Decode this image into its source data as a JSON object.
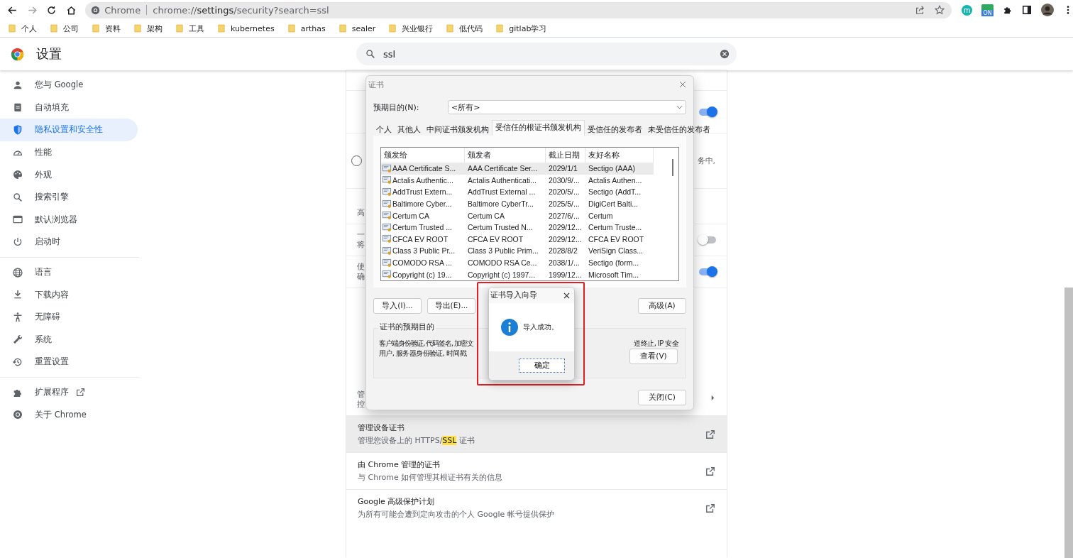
{
  "toolbar": {
    "nav": [
      {
        "kind": "back",
        "disabled": false
      },
      {
        "kind": "forward",
        "disabled": true
      },
      {
        "kind": "reload",
        "disabled": false
      },
      {
        "kind": "home",
        "disabled": false
      }
    ],
    "address_bar": {
      "site_label": "Chrome",
      "url": "chrome://**settings**/security?search=ssl"
    },
    "extensions": [
      {
        "kind": "letter",
        "text": "m"
      },
      {
        "kind": "badge",
        "text": "ON"
      },
      {
        "kind": "puzzle"
      },
      {
        "kind": "side-panel"
      },
      {
        "kind": "avatar"
      },
      {
        "kind": "menu"
      }
    ]
  },
  "bookmarks": [
    "个人",
    "公司",
    "资料",
    "架构",
    "工具",
    "kubernetes",
    "arthas",
    "sealer",
    "兴业银行",
    "低代码",
    "gitlab学习"
  ],
  "header": {
    "title": "设置",
    "search": {
      "value": "ssl"
    }
  },
  "sidebar": {
    "groups": [
      [
        {
          "kind": "person",
          "label": "您与 Google",
          "selected": false
        },
        {
          "kind": "clipboard",
          "label": "自动填充",
          "selected": false
        },
        {
          "kind": "shield",
          "label": "隐私设置和安全性",
          "selected": true
        },
        {
          "kind": "gauge",
          "label": "性能",
          "selected": false
        },
        {
          "kind": "palette",
          "label": "外观",
          "selected": false
        },
        {
          "kind": "search",
          "label": "搜索引擎",
          "selected": false
        },
        {
          "kind": "browser",
          "label": "默认浏览器",
          "selected": false
        },
        {
          "kind": "power",
          "label": "启动时",
          "selected": false
        }
      ],
      [
        {
          "kind": "globe",
          "label": "语言",
          "selected": false
        },
        {
          "kind": "download",
          "label": "下载内容",
          "selected": false
        },
        {
          "kind": "accessibility",
          "label": "无障碍",
          "selected": false
        },
        {
          "kind": "wrench",
          "label": "系统",
          "selected": false
        },
        {
          "kind": "history",
          "label": "重置设置",
          "selected": false
        }
      ],
      [
        {
          "kind": "puzzle",
          "label": "扩展程序",
          "selected": false,
          "external": true
        },
        {
          "kind": "chrome",
          "label": "关于 Chrome",
          "selected": false,
          "external": false
        }
      ]
    ]
  },
  "card": {
    "rows": [
      {
        "kind": "toggle",
        "on": true
      },
      {
        "kind": "radio",
        "selected": false,
        "right_text": "务中,"
      },
      {
        "kind": "heading",
        "left_texts": [
          "高"
        ]
      },
      {
        "kind": "toggle",
        "on": false,
        "left_texts": [
          "一",
          "将"
        ]
      },
      {
        "kind": "toggle",
        "on": true,
        "left_texts": [
          "使",
          "确"
        ]
      },
      {
        "kind": "link",
        "left_texts": [
          "管",
          "控"
        ]
      }
    ],
    "cert_rows": [
      {
        "title": "管理设备证书",
        "subtitle": [
          {
            "text": "管理您设备上的 HTTPS/",
            "match": false
          },
          {
            "text": "SSL",
            "match": true
          },
          {
            "text": " 证书",
            "match": false
          }
        ],
        "highlighted": true
      },
      {
        "title": "由 Chrome 管理的证书",
        "subtitle": [
          {
            "text": "与 Chrome 如何管理其根证书有关的信息",
            "match": false
          }
        ],
        "highlighted": false
      },
      {
        "title": "Google 高级保护计划",
        "subtitle": [
          {
            "text": "为所有可能会遭到定向攻击的个人 Google 帐号提供保护",
            "match": false
          }
        ],
        "highlighted": false
      }
    ]
  },
  "cert_dialog": {
    "title": "证书",
    "purpose_label": "预期目的(N):",
    "purpose_value": "<所有>",
    "tabs": [
      {
        "label": "个人",
        "selected": false
      },
      {
        "label": "其他人",
        "selected": false
      },
      {
        "label": "中间证书颁发机构",
        "selected": false
      },
      {
        "label": "受信任的根证书颁发机构",
        "selected": true
      },
      {
        "label": "受信任的发布者",
        "selected": false
      },
      {
        "label": "未受信任的发布者",
        "selected": false
      }
    ],
    "columns": [
      "颁发给",
      "颁发者",
      "截止日期",
      "友好名称"
    ],
    "rows": [
      {
        "cells": [
          "AAA Certificate S...",
          "AAA Certificate Ser...",
          "2029/1/1",
          "Sectigo (AAA)"
        ],
        "selected": true
      },
      {
        "cells": [
          "Actalis Authentic...",
          "Actalis Authenticati...",
          "2030/9/...",
          "Actalis Authen..."
        ],
        "selected": false
      },
      {
        "cells": [
          "AddTrust Extern...",
          "AddTrust External ...",
          "2020/5/...",
          "Sectigo (AddT..."
        ],
        "selected": false
      },
      {
        "cells": [
          "Baltimore Cyber...",
          "Baltimore CyberTr...",
          "2025/5/...",
          "DigiCert Balti..."
        ],
        "selected": false
      },
      {
        "cells": [
          "Certum CA",
          "Certum CA",
          "2027/6/...",
          "Certum"
        ],
        "selected": false
      },
      {
        "cells": [
          "Certum Trusted ...",
          "Certum Trusted N...",
          "2029/12...",
          "Certum Truste..."
        ],
        "selected": false
      },
      {
        "cells": [
          "CFCA EV ROOT",
          "CFCA EV ROOT",
          "2029/12...",
          "CFCA EV ROOT"
        ],
        "selected": false
      },
      {
        "cells": [
          "Class 3 Public Pr...",
          "Class 3 Public Prim...",
          "2028/8/2",
          "VeriSign Class..."
        ],
        "selected": false
      },
      {
        "cells": [
          "COMODO RSA ...",
          "COMODO RSA Ce...",
          "2038/1/...",
          "Sectigo (form..."
        ],
        "selected": false
      },
      {
        "cells": [
          "Copyright (c) 19...",
          "Copyright (c) 1997...",
          "1999/12...",
          "Microsoft Tim..."
        ],
        "selected": false
      }
    ],
    "buttons_left": [
      "导入(I)...",
      "导出(E)..."
    ],
    "advanced_button": "高级(A)",
    "group_title": "证书的预期目的",
    "purposes_left": "客户端身份验证, 代码签名, 加密文",
    "purposes_right": "道终止, IP 安全",
    "purposes_line2": "用户, 服务器身份验证, 时间戳",
    "view_button": "查看(V)",
    "close_button": "关闭(C)"
  },
  "import_dialog": {
    "title": "证书导入向导",
    "message": "导入成功。",
    "ok_button": "确定",
    "highlighted": true
  }
}
